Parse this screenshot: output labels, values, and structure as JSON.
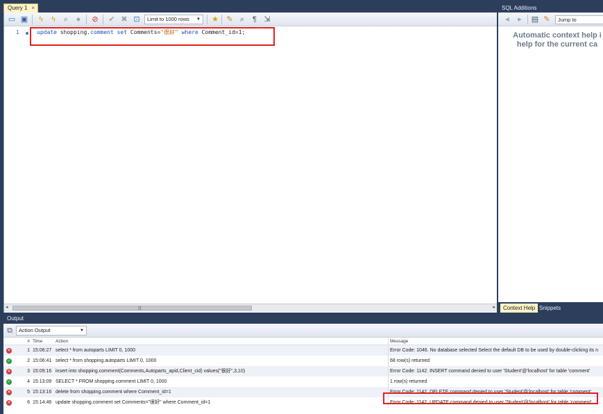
{
  "query_tab": {
    "label": "Query 1",
    "close": "×"
  },
  "toolbar": {
    "limit_label": "Limit to 1000 rows"
  },
  "editor": {
    "line_number": "1",
    "code": {
      "kw_update": "update",
      "table": " shopping.",
      "table_name": "comment",
      "kw_set": " set",
      "assign": " Comments=",
      "value": "\"很好\"",
      "kw_where": " where",
      "cond": " Comment_id=1;"
    }
  },
  "sql_additions": {
    "title": "SQL Additions",
    "jump_to": "Jump to",
    "help_line1": "Automatic context help i",
    "help_line2": "help for the current ca",
    "tab_context_help": "Context Help",
    "tab_snippets": "Snippets"
  },
  "output": {
    "title": "Output",
    "mode": "Action Output",
    "columns": {
      "num": "#",
      "time": "Time",
      "action": "Action",
      "message": "Message"
    },
    "rows": [
      {
        "status": "error",
        "num": "1",
        "time": "15:06:27",
        "action": "select * from autoparts LIMIT 0, 1000",
        "message": "Error Code: 1046. No database selected Select the default DB to be used by double-clicking its n"
      },
      {
        "status": "ok",
        "num": "2",
        "time": "15:06:41",
        "action": "select * from shopping.autoparts LIMIT 0, 1000",
        "message": "68 row(s) returned"
      },
      {
        "status": "error",
        "num": "3",
        "time": "15:09:16",
        "action": "insert into shopping.comment(Comments,Autoparts_apid,Client_cid) values(\"很好\",3,10)",
        "message": "Error Code: 1142. INSERT command denied to user 'Student'@'localhost' for table 'comment'"
      },
      {
        "status": "ok",
        "num": "4",
        "time": "15:13:09",
        "action": "SELECT * FROM shopping.comment LIMIT 0, 1000",
        "message": "1 row(s) returned"
      },
      {
        "status": "error",
        "num": "5",
        "time": "15:13:16",
        "action": "delete from shopping.comment where Comment_id=1",
        "message": "Error Code: 1142. DELETE command denied to user 'Student'@'localhost' for table 'comment'"
      },
      {
        "status": "error",
        "num": "6",
        "time": "15:14:46",
        "action": "update shopping.comment set Comments=\"很好\" where Comment_id=1",
        "message": "Error Code: 1142. UPDATE command denied to user 'Student'@'localhost' for table 'comment'"
      }
    ]
  },
  "colors": {
    "frame": "#2c3e5c",
    "keyword": "#1d4fb4",
    "string": "#b85a00",
    "highlight": "#e02020",
    "error": "#d13a3a",
    "ok": "#2f9e3f"
  }
}
